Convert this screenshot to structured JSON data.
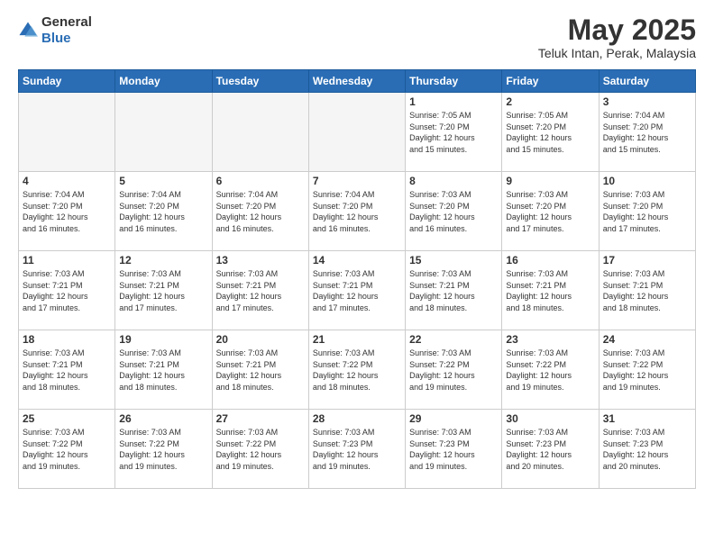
{
  "header": {
    "logo_general": "General",
    "logo_blue": "Blue",
    "month_title": "May 2025",
    "subtitle": "Teluk Intan, Perak, Malaysia"
  },
  "days_of_week": [
    "Sunday",
    "Monday",
    "Tuesday",
    "Wednesday",
    "Thursday",
    "Friday",
    "Saturday"
  ],
  "weeks": [
    [
      {
        "day": "",
        "info": ""
      },
      {
        "day": "",
        "info": ""
      },
      {
        "day": "",
        "info": ""
      },
      {
        "day": "",
        "info": ""
      },
      {
        "day": "1",
        "info": "Sunrise: 7:05 AM\nSunset: 7:20 PM\nDaylight: 12 hours\nand 15 minutes."
      },
      {
        "day": "2",
        "info": "Sunrise: 7:05 AM\nSunset: 7:20 PM\nDaylight: 12 hours\nand 15 minutes."
      },
      {
        "day": "3",
        "info": "Sunrise: 7:04 AM\nSunset: 7:20 PM\nDaylight: 12 hours\nand 15 minutes."
      }
    ],
    [
      {
        "day": "4",
        "info": "Sunrise: 7:04 AM\nSunset: 7:20 PM\nDaylight: 12 hours\nand 16 minutes."
      },
      {
        "day": "5",
        "info": "Sunrise: 7:04 AM\nSunset: 7:20 PM\nDaylight: 12 hours\nand 16 minutes."
      },
      {
        "day": "6",
        "info": "Sunrise: 7:04 AM\nSunset: 7:20 PM\nDaylight: 12 hours\nand 16 minutes."
      },
      {
        "day": "7",
        "info": "Sunrise: 7:04 AM\nSunset: 7:20 PM\nDaylight: 12 hours\nand 16 minutes."
      },
      {
        "day": "8",
        "info": "Sunrise: 7:03 AM\nSunset: 7:20 PM\nDaylight: 12 hours\nand 16 minutes."
      },
      {
        "day": "9",
        "info": "Sunrise: 7:03 AM\nSunset: 7:20 PM\nDaylight: 12 hours\nand 17 minutes."
      },
      {
        "day": "10",
        "info": "Sunrise: 7:03 AM\nSunset: 7:20 PM\nDaylight: 12 hours\nand 17 minutes."
      }
    ],
    [
      {
        "day": "11",
        "info": "Sunrise: 7:03 AM\nSunset: 7:21 PM\nDaylight: 12 hours\nand 17 minutes."
      },
      {
        "day": "12",
        "info": "Sunrise: 7:03 AM\nSunset: 7:21 PM\nDaylight: 12 hours\nand 17 minutes."
      },
      {
        "day": "13",
        "info": "Sunrise: 7:03 AM\nSunset: 7:21 PM\nDaylight: 12 hours\nand 17 minutes."
      },
      {
        "day": "14",
        "info": "Sunrise: 7:03 AM\nSunset: 7:21 PM\nDaylight: 12 hours\nand 17 minutes."
      },
      {
        "day": "15",
        "info": "Sunrise: 7:03 AM\nSunset: 7:21 PM\nDaylight: 12 hours\nand 18 minutes."
      },
      {
        "day": "16",
        "info": "Sunrise: 7:03 AM\nSunset: 7:21 PM\nDaylight: 12 hours\nand 18 minutes."
      },
      {
        "day": "17",
        "info": "Sunrise: 7:03 AM\nSunset: 7:21 PM\nDaylight: 12 hours\nand 18 minutes."
      }
    ],
    [
      {
        "day": "18",
        "info": "Sunrise: 7:03 AM\nSunset: 7:21 PM\nDaylight: 12 hours\nand 18 minutes."
      },
      {
        "day": "19",
        "info": "Sunrise: 7:03 AM\nSunset: 7:21 PM\nDaylight: 12 hours\nand 18 minutes."
      },
      {
        "day": "20",
        "info": "Sunrise: 7:03 AM\nSunset: 7:21 PM\nDaylight: 12 hours\nand 18 minutes."
      },
      {
        "day": "21",
        "info": "Sunrise: 7:03 AM\nSunset: 7:22 PM\nDaylight: 12 hours\nand 18 minutes."
      },
      {
        "day": "22",
        "info": "Sunrise: 7:03 AM\nSunset: 7:22 PM\nDaylight: 12 hours\nand 19 minutes."
      },
      {
        "day": "23",
        "info": "Sunrise: 7:03 AM\nSunset: 7:22 PM\nDaylight: 12 hours\nand 19 minutes."
      },
      {
        "day": "24",
        "info": "Sunrise: 7:03 AM\nSunset: 7:22 PM\nDaylight: 12 hours\nand 19 minutes."
      }
    ],
    [
      {
        "day": "25",
        "info": "Sunrise: 7:03 AM\nSunset: 7:22 PM\nDaylight: 12 hours\nand 19 minutes."
      },
      {
        "day": "26",
        "info": "Sunrise: 7:03 AM\nSunset: 7:22 PM\nDaylight: 12 hours\nand 19 minutes."
      },
      {
        "day": "27",
        "info": "Sunrise: 7:03 AM\nSunset: 7:22 PM\nDaylight: 12 hours\nand 19 minutes."
      },
      {
        "day": "28",
        "info": "Sunrise: 7:03 AM\nSunset: 7:23 PM\nDaylight: 12 hours\nand 19 minutes."
      },
      {
        "day": "29",
        "info": "Sunrise: 7:03 AM\nSunset: 7:23 PM\nDaylight: 12 hours\nand 19 minutes."
      },
      {
        "day": "30",
        "info": "Sunrise: 7:03 AM\nSunset: 7:23 PM\nDaylight: 12 hours\nand 20 minutes."
      },
      {
        "day": "31",
        "info": "Sunrise: 7:03 AM\nSunset: 7:23 PM\nDaylight: 12 hours\nand 20 minutes."
      }
    ]
  ]
}
